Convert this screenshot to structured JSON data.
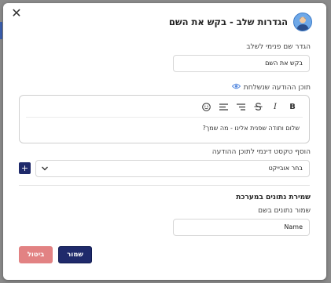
{
  "dialog": {
    "title": "הגדרות שלב - בקש את השם",
    "close_glyph": "✕"
  },
  "step_name": {
    "label": "הגדר שם פנימי לשלב",
    "value": "בקש את השם"
  },
  "message": {
    "label": "תוכן ההודעה שנשלחת",
    "toolbar": [
      "B",
      "I",
      "S",
      "align-right",
      "align-center",
      "emoji"
    ],
    "text": "שלום ותודה שפנית אלינו - מה שמך?"
  },
  "dynamic_text": {
    "label": "הוסף טקסט דינמי לתוכן ההודעה",
    "select_value": "בחר אובייקט",
    "add_glyph": "+"
  },
  "data_save": {
    "section_title": "שמירת נתונים במערכת",
    "label": "שמור נתונים בשם",
    "value": "Name"
  },
  "buttons": {
    "save": "שמור",
    "cancel": "ביטול"
  },
  "colors": {
    "primary": "#1f2a6b",
    "cancel": "#e28283",
    "accent_eye": "#5a8de0"
  }
}
